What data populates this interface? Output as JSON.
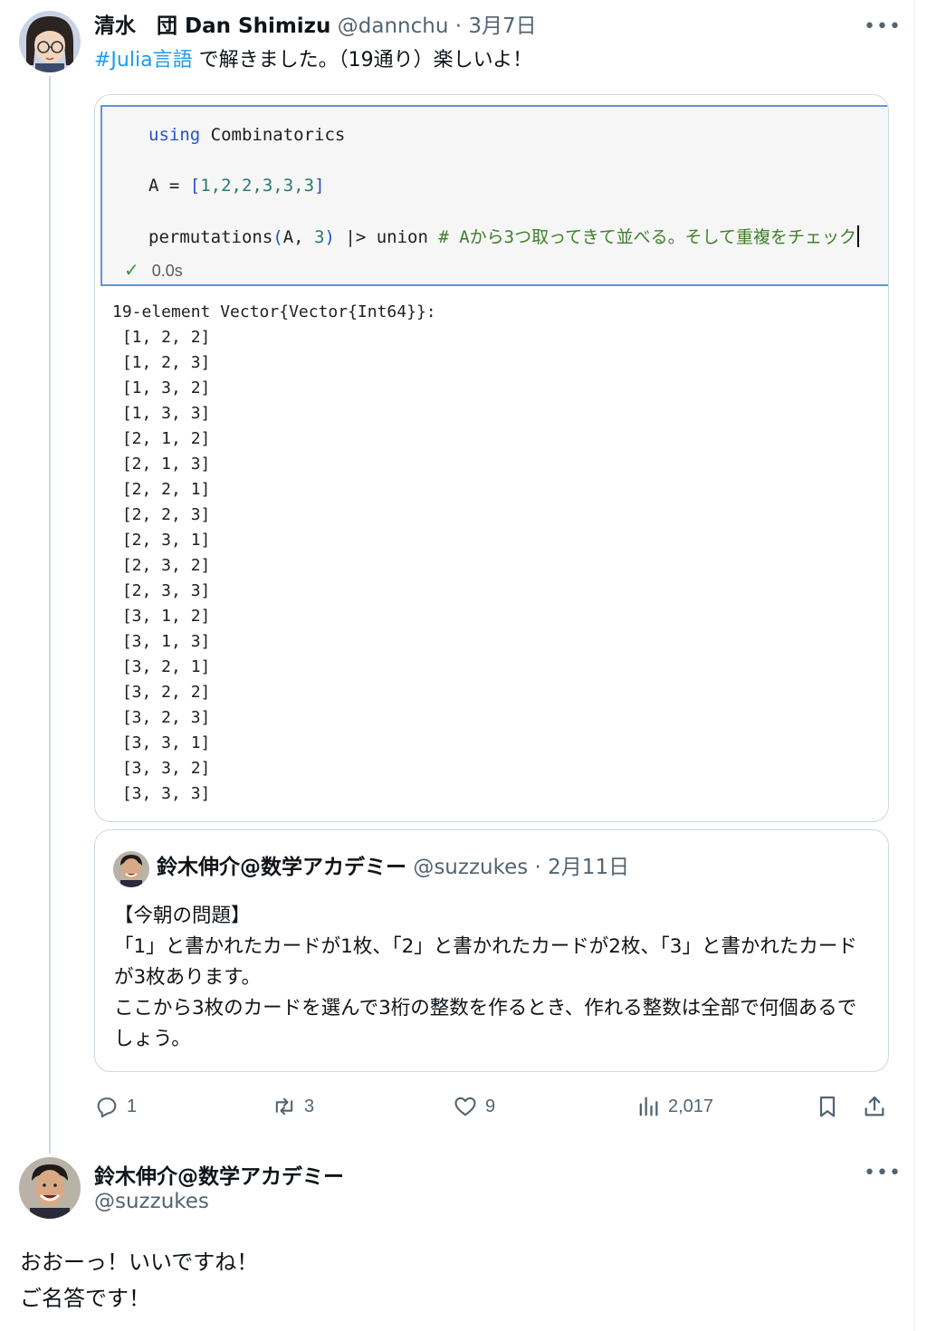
{
  "tweet": {
    "author_name": "清水　団 Dan Shimizu",
    "handle": "@dannchu",
    "separator": "·",
    "date": "3月7日",
    "more_label": "•••",
    "hashtag": "#Julia言語",
    "text": " で解きました。（19通り）楽しいよ！"
  },
  "code_cell": {
    "line1": {
      "keyword": "using",
      "rest": " Combinatorics"
    },
    "line2": {
      "lhs": "A = ",
      "open": "[",
      "values": "1,2,2,3,3,3",
      "close": "]"
    },
    "line3": {
      "fn": "permutations",
      "open": "(",
      "arg": "A, ",
      "num": "3",
      "close": ")",
      "pipe": " |> union ",
      "comment": "# Aから3つ取ってきて並べる。そして重複をチェック"
    },
    "exec_mark": "✓",
    "exec_time": "0.0s",
    "output_header": "19-element Vector{Vector{Int64}}:",
    "output_rows": [
      " [1, 2, 2]",
      " [1, 2, 3]",
      " [1, 3, 2]",
      " [1, 3, 3]",
      " [2, 1, 2]",
      " [2, 1, 3]",
      " [2, 2, 1]",
      " [2, 2, 3]",
      " [2, 3, 1]",
      " [2, 3, 2]",
      " [2, 3, 3]",
      " [3, 1, 2]",
      " [3, 1, 3]",
      " [3, 2, 1]",
      " [3, 2, 2]",
      " [3, 2, 3]",
      " [3, 3, 1]",
      " [3, 3, 2]",
      " [3, 3, 3]"
    ]
  },
  "quote": {
    "author_name": "鈴木伸介@数学アカデミー",
    "handle": "@suzzukes",
    "separator": "·",
    "date": "2月11日",
    "line1": "【今朝の問題】",
    "line2": "「1」と書かれたカードが1枚、「2」と書かれたカードが2枚、「3」と書かれたカードが3枚あります。",
    "line3": "ここから3枚のカードを選んで3桁の整数を作るとき、作れる整数は全部で何個あるでしょう。"
  },
  "actions": {
    "reply_count": "1",
    "retweet_count": "3",
    "like_count": "9",
    "views_count": "2,017"
  },
  "reply": {
    "author_name": "鈴木伸介@数学アカデミー",
    "handle": "@suzzukes",
    "more_label": "•••",
    "text": "おおーっ！いいですね！\nご名答です！"
  },
  "colors": {
    "link": "#1d9bf0",
    "secondary_text": "#536471",
    "border": "#cfd9de",
    "code_keyword": "#2550c9",
    "code_comment": "#3f7f2a",
    "cell_border": "#5b97d8"
  }
}
